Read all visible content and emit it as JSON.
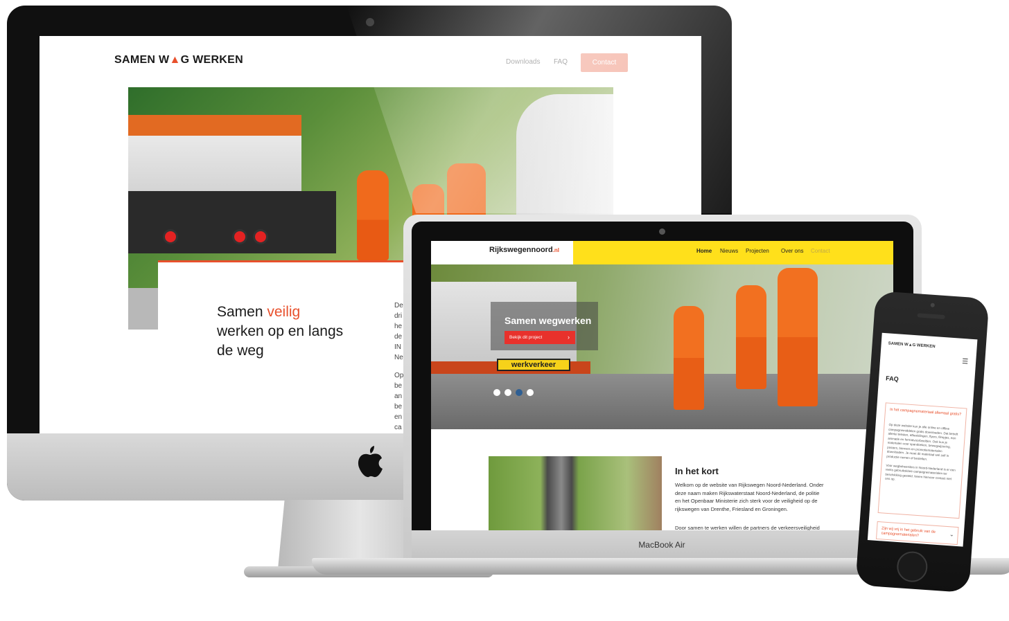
{
  "imac_site": {
    "logo": {
      "part1": "SAMEN W",
      "cone": "▲",
      "part2": "G WERKEN"
    },
    "nav": [
      "Downloads",
      "FAQ"
    ],
    "contact_button": "Contact",
    "hero_title": {
      "line1_a": "Samen ",
      "line1_b": "veilig",
      "line2": "werken op en langs",
      "line3": "de weg"
    },
    "intro_text_fragments": [
      "De",
      "dri",
      "he",
      "de",
      "IN",
      "Ne",
      "Op",
      "be",
      "an",
      "be",
      "en",
      "ca"
    ]
  },
  "macbook_site": {
    "logo": "Rijkswegennoord",
    "logo_tld": ".nl",
    "nav": [
      {
        "label": "Home",
        "state": "active"
      },
      {
        "label": "Nieuws",
        "state": "normal"
      },
      {
        "label": "Projecten",
        "state": "normal"
      },
      {
        "label": "Over ons",
        "state": "normal"
      },
      {
        "label": "Contact",
        "state": "muted"
      }
    ],
    "hero_title": "Samen wegwerken",
    "hero_button": "Bekijk dit project",
    "hero_button_arrow": "›",
    "sign_text": "werkverkeer",
    "carousel_dots": 4,
    "carousel_active": 3,
    "section_title": "In het kort",
    "section_text": "Welkom op de website van Rijkswegen Noord-Nederland. Onder deze naam maken Rijkswaterstaat Noord-Nederland, de politie en het Openbaar Ministerie zich sterk voor de veiligheid op de rijkswegen van Drenthe, Friesland en Groningen.",
    "section_text2": "Door samen te werken willen de partners de verkeersveiligheid op"
  },
  "macbook_label": "MacBook Air",
  "phone_site": {
    "logo": "SAMEN W▲G WERKEN",
    "menu_icon": "☰",
    "heading": "FAQ",
    "question1": "Is het campagnemateriaal allemaal gratis?",
    "answer1": "Op deze website kun je alle online en offline campagnemiddelen gratis downloaden. Dat betreft allerlei teksten, afbeeldingen, flyers, filmpjes, een animatie en formatvoorbeelden. Ook kun je materialen voor spandoeken, bewegwijzering, posters, banners en promotiematerialen downloaden. Je moet dit materiaal wel zelf in productie nemen of bestellen.",
    "answer1b": "Voor wegbeheerders in Noord-Nederland is er een reeks gebruiksklare campagnematerialen ter beschikking gesteld. Neem hiervoor contact met ons op.",
    "question2": "Zijn wij vrij in het gebruik van de campagnematerialen?",
    "chevron": "⌄"
  },
  "colors": {
    "brand_orange": "#e8502c",
    "rw_yellow": "#ffe01b",
    "rw_red_button": "#e8312c",
    "contact_button_bg": "#f4b3a4"
  }
}
